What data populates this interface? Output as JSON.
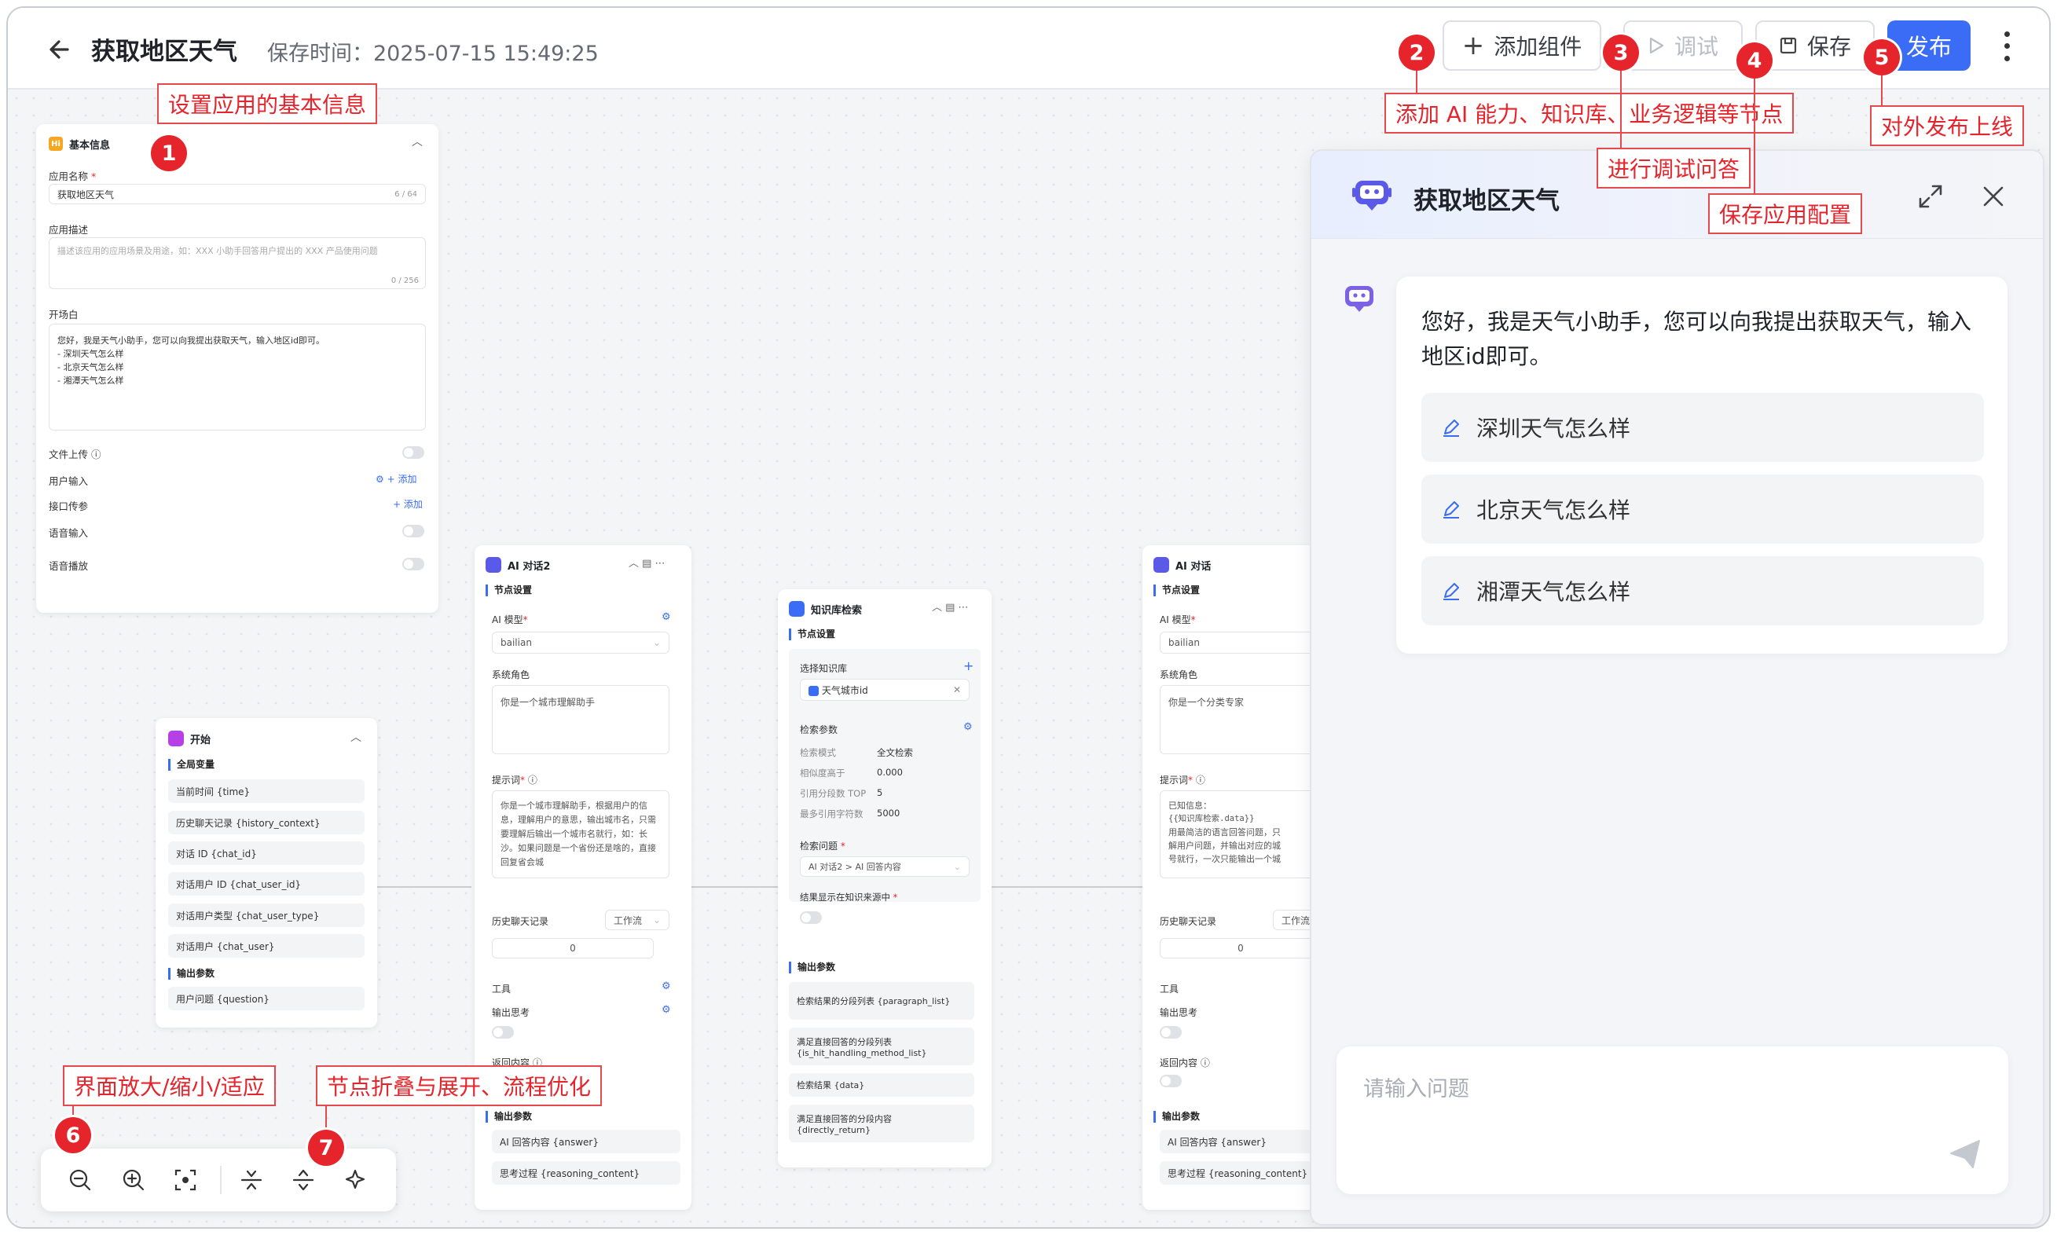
{
  "header": {
    "title": "获取地区天气",
    "save_time": "保存时间：2025-07-15 15:49:25",
    "add_component": "添加组件",
    "debug": "调试",
    "save": "保存",
    "publish": "发布"
  },
  "basic_info": {
    "title": "基本信息",
    "app_name_label": "应用名称",
    "app_name_value": "获取地区天气",
    "app_name_count": "6 / 64",
    "desc_label": "应用描述",
    "desc_placeholder": "描述该应用的应用场景及用途，如：XXX 小助手回答用户提出的 XXX 产品使用问题",
    "desc_count": "0 / 256",
    "opening_label": "开场白",
    "opening_lines": [
      "您好，我是天气小助手，您可以向我提出获取天气，输入地区id即可。",
      "- 深圳天气怎么样",
      "- 北京天气怎么样",
      "- 湘潭天气怎么样"
    ],
    "file_upload": "文件上传",
    "user_input": "用户输入",
    "interface_param": "接口传参",
    "add": "+ 添加",
    "voice_input": "语音输入",
    "voice_play": "语音播放"
  },
  "start_node": {
    "title": "开始",
    "global_vars": "全局变量",
    "vars": [
      "当前时间 {time}",
      "历史聊天记录 {history_context}",
      "对话 ID {chat_id}",
      "对话用户 ID {chat_user_id}",
      "对话用户类型 {chat_user_type}",
      "对话用户 {chat_user}"
    ],
    "output_params": "输出参数",
    "outputs": [
      "用户问题 {question}"
    ]
  },
  "ai_node2": {
    "title": "AI 对话2",
    "node_settings": "节点设置",
    "model_label": "AI 模型",
    "model_value": "bailian",
    "system_role_label": "系统角色",
    "system_role_value": "你是一个城市理解助手",
    "prompt_label": "提示词",
    "prompt_value": "你是一个城市理解助手，根据用户的信息，理解用户的意思，输出城市名，只需要理解后输出一个城市名就行，如：长沙。如果问题是一个省份还是啥的，直接回复省会城",
    "history_label": "历史聊天记录",
    "history_type": "工作流",
    "history_value": "0",
    "tools": "工具",
    "output_thinking": "输出思考",
    "return_content": "返回内容",
    "output_params": "输出参数",
    "outputs": [
      "AI 回答内容 {answer}",
      "思考过程 {reasoning_content}"
    ]
  },
  "kb_node": {
    "title": "知识库检索",
    "node_settings": "节点设置",
    "select_kb": "选择知识库",
    "kb_name": "天气城市id",
    "search_params": "检索参数",
    "params": [
      {
        "k": "检索模式",
        "v": "全文检索"
      },
      {
        "k": "相似度高于",
        "v": "0.000"
      },
      {
        "k": "引用分段数 TOP",
        "v": "5"
      },
      {
        "k": "最多引用字符数",
        "v": "5000"
      }
    ],
    "question_label": "检索问题",
    "question_value": "AI 对话2 > AI 回答内容",
    "show_source": "结果显示在知识来源中",
    "output_params": "输出参数",
    "outputs": [
      "检索结果的分段列表 {paragraph_list}",
      "满足直接回答的分段列表 {is_hit_handling_method_list}",
      "检索结果 {data}",
      "满足直接回答的分段内容 {directly_return}"
    ]
  },
  "ai_node": {
    "title": "AI 对话",
    "node_settings": "节点设置",
    "model_label": "AI 模型",
    "model_value": "bailian",
    "system_role_label": "系统角色",
    "system_role_value": "你是一个分类专家",
    "prompt_label": "提示词",
    "prompt_lines": [
      "已知信息：",
      "{{知识库检索.data}}",
      "用最简洁的语言回答问题，只",
      "解用户问题，并输出对应的城",
      "号就行，一次只能输出一个城"
    ],
    "history_label": "历史聊天记录",
    "history_type": "工作流",
    "history_value": "0",
    "tools": "工具",
    "output_thinking": "输出思考",
    "return_content": "返回内容",
    "output_params": "输出参数",
    "outputs": [
      "AI 回答内容 {answer}",
      "思考过程 {reasoning_content}"
    ]
  },
  "chat": {
    "title": "获取地区天气",
    "greeting": "您好，我是天气小助手，您可以向我提出获取天气，输入地区id即可。",
    "suggestions": [
      "深圳天气怎么样",
      "北京天气怎么样",
      "湘潭天气怎么样"
    ],
    "input_placeholder": "请输入问题"
  },
  "annotations": {
    "n1": {
      "num": "1",
      "text": "设置应用的基本信息"
    },
    "n2": {
      "num": "2",
      "text": "添加 AI 能力、知识库、业务逻辑等节点"
    },
    "n3": {
      "num": "3",
      "text": "进行调试问答"
    },
    "n4": {
      "num": "4",
      "text": "保存应用配置"
    },
    "n5": {
      "num": "5",
      "text": "对外发布上线"
    },
    "n6": {
      "num": "6",
      "text": "界面放大/缩小/适应"
    },
    "n7": {
      "num": "7",
      "text": "节点折叠与展开、流程优化"
    }
  },
  "colors": {
    "accent": "#3b6cf6",
    "annotation": "#e5242b",
    "canvas": "#f4f5f7"
  }
}
